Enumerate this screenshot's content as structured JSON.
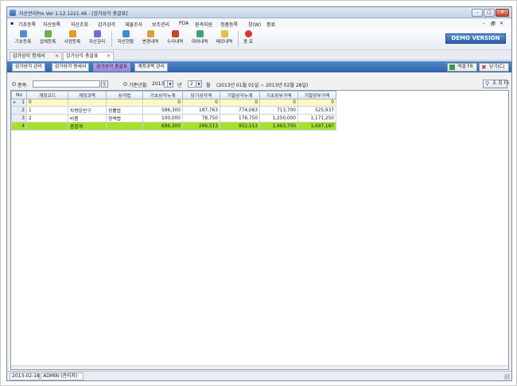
{
  "window": {
    "title": "자산관리Pro Ver 1.12.1221.46 - [감가상각 총괄표]",
    "controls": {
      "minimize": "–",
      "maximize": "□",
      "close": "✕"
    }
  },
  "menu": {
    "items": [
      "기초등록",
      "자산등록",
      "자산조회",
      "감가상각",
      "재물조사",
      "보조관리",
      "PDA",
      "원격지원",
      "정품등록",
      "창(W)",
      "종료"
    ],
    "mdi_controls": [
      "–",
      "🗗",
      "✕"
    ]
  },
  "toolbar": {
    "buttons": [
      {
        "label": "기초등록",
        "icon": "folder-icon",
        "color": "#4f8fd8"
      },
      {
        "label": "업체등록",
        "icon": "building-icon",
        "color": "#6ab04c"
      },
      {
        "label": "사원등록",
        "icon": "people-icon",
        "color": "#e39b2a"
      },
      {
        "label": "자산관리",
        "icon": "box-icon",
        "color": "#7a6bd0"
      },
      {
        "label": "자산현황",
        "icon": "list-icon",
        "color": "#3f8fc9"
      },
      {
        "label": "변경내역",
        "icon": "edit-icon",
        "color": "#d9a23a"
      },
      {
        "label": "수리내역",
        "icon": "wrench-icon",
        "color": "#c8452e"
      },
      {
        "label": "대여내역",
        "icon": "handover-icon",
        "color": "#3aa37a"
      },
      {
        "label": "메모내역",
        "icon": "memo-icon",
        "color": "#e6c23a"
      },
      {
        "label": "종 료",
        "icon": "power-icon",
        "color": "#d23a2a"
      }
    ],
    "demo_badge": "DEMO VERSION"
  },
  "doc_tabs": [
    {
      "label": "감가상각 명세서",
      "close": "✕"
    },
    {
      "label": "감가상각 총괄표",
      "close": "✕"
    }
  ],
  "sub_tabs": [
    "감가상각 관리",
    "감가상각 명세서",
    "감가상각 총괄표",
    "계정과목 관리"
  ],
  "actions": {
    "excel_label": "엑셀 F8",
    "close_label": "닫기(C)",
    "query_label": "조 회 F5"
  },
  "search": {
    "type_label": "종목:",
    "type_value": "",
    "period_label": "기준년월:",
    "year": "2013",
    "year_unit": "년",
    "month": "2",
    "month_unit": "월",
    "range_text": "(2013년 01월 01일 ~ 2013년 02월 28일)"
  },
  "grid": {
    "columns": [
      "No",
      "계정코드",
      "계정과목",
      "상각법",
      "기초상각누계",
      "당기상각액",
      "기말상각누계",
      "기초장부가액",
      "기말장부가액"
    ],
    "rows": [
      {
        "no": "1",
        "code": "0",
        "account": "",
        "method": "",
        "c1": "0",
        "c2": "0",
        "c3": "0",
        "c4": "0",
        "c5": "0",
        "current": true
      },
      {
        "no": "2",
        "code": "1",
        "account": "차량운반구",
        "method": "정률법",
        "c1": "586,300",
        "c2": "187,763",
        "c3": "774,063",
        "c4": "713,700",
        "c5": "525,937"
      },
      {
        "no": "3",
        "code": "2",
        "account": "비품",
        "method": "정액법",
        "c1": "100,000",
        "c2": "78,750",
        "c3": "178,750",
        "c4": "1,250,000",
        "c5": "1,171,250"
      },
      {
        "no": "4",
        "code": "",
        "account": "총합계",
        "method": "",
        "c1": "686,300",
        "c2": "266,513",
        "c3": "952,513",
        "c4": "1,963,700",
        "c5": "1,697,187",
        "total": true
      }
    ]
  },
  "status": {
    "date": "2013-02-18",
    "user": "ADMIN (관리자)"
  }
}
